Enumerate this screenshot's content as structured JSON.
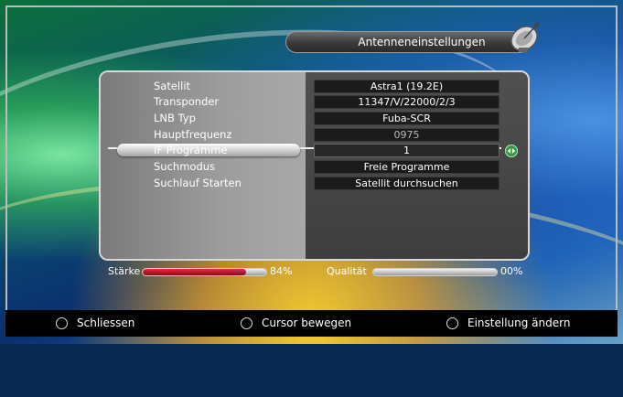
{
  "header": {
    "title": "Antenneneinstellungen",
    "icon": "satellite-dish-icon"
  },
  "settings": [
    {
      "label": "Satellit",
      "value": "Astra1 (19.2E)"
    },
    {
      "label": "Transponder",
      "value": "11347/V/22000/2/3"
    },
    {
      "label": "LNB Typ",
      "value": "Fuba-SCR"
    },
    {
      "label": "Hauptfrequenz",
      "value": "0975"
    },
    {
      "label": "IF Programme",
      "value": "1"
    },
    {
      "label": "Suchmodus",
      "value": "Freie Programme"
    },
    {
      "label": "Suchlauf Starten",
      "value": "Satellit durchsuchen"
    }
  ],
  "selected_label": "IF Programme",
  "signal": {
    "strength_label": "Stärke",
    "strength_value": "84%",
    "strength_level": 0.84,
    "quality_label": "Qualität",
    "quality_value": "00%",
    "quality_level": 0.0
  },
  "footer": {
    "exit": {
      "icon": "exit-icon",
      "label": "Schliessen"
    },
    "move": {
      "icon": "cursor-pad-icon",
      "label": "Cursor bewegen"
    },
    "change": {
      "icon": "left-right-arrows-icon",
      "label": "Einstellung ändern"
    }
  },
  "colors": {
    "strength_fill": "#c8141e",
    "quality_fill": "#9a9a9a",
    "selector_icon": "#2f9a3f"
  }
}
